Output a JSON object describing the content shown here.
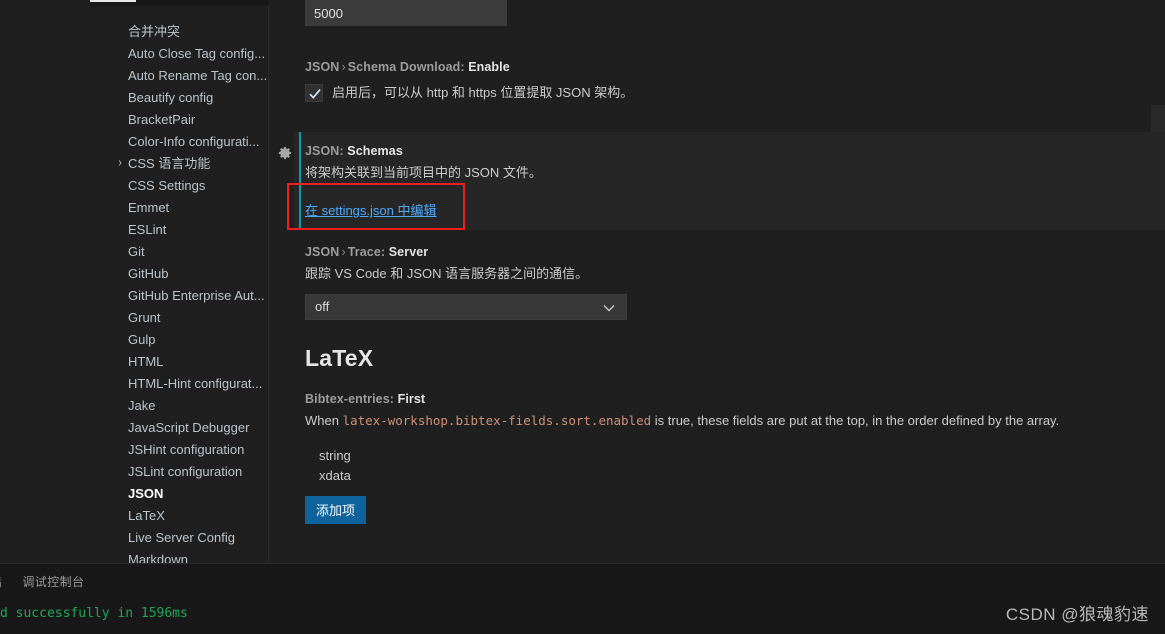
{
  "toc": {
    "items": [
      {
        "label": "合并冲突",
        "expandable": false,
        "selected": false
      },
      {
        "label": "Auto Close Tag config...",
        "expandable": false,
        "selected": false
      },
      {
        "label": "Auto Rename Tag con...",
        "expandable": false,
        "selected": false
      },
      {
        "label": "Beautify config",
        "expandable": false,
        "selected": false
      },
      {
        "label": "BracketPair",
        "expandable": false,
        "selected": false
      },
      {
        "label": "Color-Info configurati...",
        "expandable": false,
        "selected": false
      },
      {
        "label": "CSS 语言功能",
        "expandable": true,
        "selected": false
      },
      {
        "label": "CSS Settings",
        "expandable": false,
        "selected": false
      },
      {
        "label": "Emmet",
        "expandable": false,
        "selected": false
      },
      {
        "label": "ESLint",
        "expandable": false,
        "selected": false
      },
      {
        "label": "Git",
        "expandable": false,
        "selected": false
      },
      {
        "label": "GitHub",
        "expandable": false,
        "selected": false
      },
      {
        "label": "GitHub Enterprise Aut...",
        "expandable": false,
        "selected": false
      },
      {
        "label": "Grunt",
        "expandable": false,
        "selected": false
      },
      {
        "label": "Gulp",
        "expandable": false,
        "selected": false
      },
      {
        "label": "HTML",
        "expandable": false,
        "selected": false
      },
      {
        "label": "HTML-Hint configurat...",
        "expandable": false,
        "selected": false
      },
      {
        "label": "Jake",
        "expandable": false,
        "selected": false
      },
      {
        "label": "JavaScript Debugger",
        "expandable": false,
        "selected": false
      },
      {
        "label": "JSHint configuration",
        "expandable": false,
        "selected": false
      },
      {
        "label": "JSLint configuration",
        "expandable": false,
        "selected": false
      },
      {
        "label": "JSON",
        "expandable": false,
        "selected": true
      },
      {
        "label": "LaTeX",
        "expandable": false,
        "selected": false
      },
      {
        "label": "Live Server Config",
        "expandable": false,
        "selected": false
      },
      {
        "label": "Markdown",
        "expandable": false,
        "selected": false
      }
    ],
    "twisty_glyph": "›"
  },
  "settings": {
    "number_input": {
      "value": "5000"
    },
    "schema_download": {
      "prefix": "JSON",
      "separator": "›",
      "middle": "Schema Download:",
      "key": "Enable",
      "description": "启用后，可以从 http 和 https 位置提取 JSON 架构。",
      "checked": true
    },
    "schemas": {
      "prefix": "JSON:",
      "key": "Schemas",
      "description": "将架构关联到当前项目中的 JSON 文件。",
      "link_label": "在 settings.json 中编辑",
      "gear_icon": "gear-icon",
      "modified": true,
      "annotated": true
    },
    "trace_server": {
      "prefix": "JSON",
      "separator": "›",
      "middle": "Trace:",
      "key": "Server",
      "description": "跟踪 VS Code 和 JSON 语言服务器之间的通信。",
      "dropdown_value": "off"
    },
    "latex_heading": "LaTeX",
    "bibtex_entries": {
      "prefix": "Bibtex-entries:",
      "key": "First",
      "desc_before": "When ",
      "desc_code": "latex-workshop.bibtex-fields.sort.enabled",
      "desc_after": " is true, these fields are put at the top, in the order defined by the array.",
      "items": [
        "string",
        "xdata"
      ],
      "add_button_label": "添加项"
    }
  },
  "panel": {
    "tabs": [
      {
        "label": "出",
        "active": false
      },
      {
        "label": "调试控制台",
        "active": false
      }
    ],
    "output_line": "d successfully in 1596ms"
  },
  "watermark": "CSDN @狼魂豹速",
  "colors": {
    "editor_bg": "#1f1f1f",
    "panel_bg": "#181818",
    "accent_link": "#4daafc",
    "modified_indicator": "#0d9aa8",
    "annotation": "#f01f1f",
    "button_primary": "#0e639c",
    "terminal_green": "#23a559",
    "code_orange": "#ce9178"
  }
}
